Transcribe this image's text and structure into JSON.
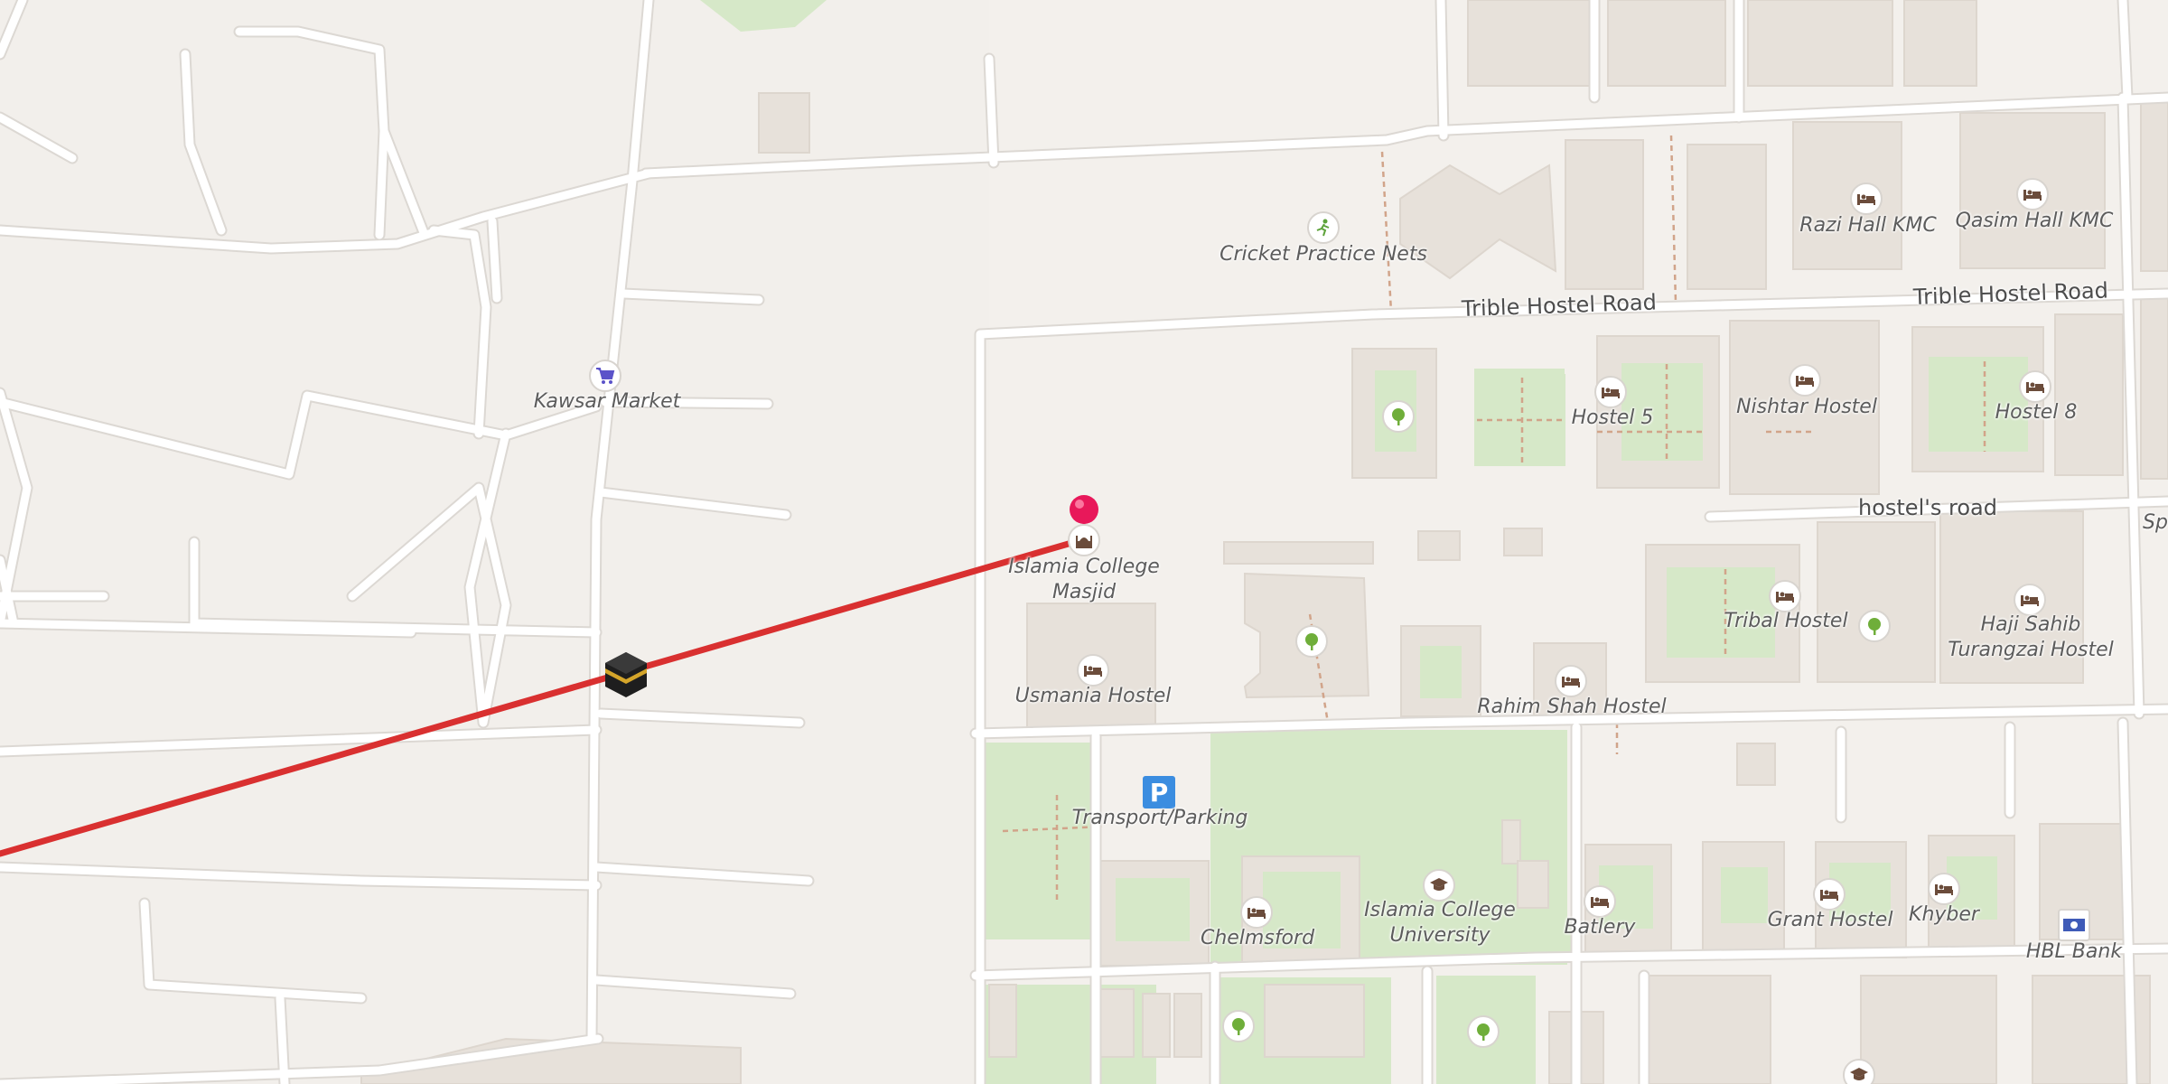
{
  "map": {
    "colors": {
      "background": "#f3f0ec",
      "road": "#ffffff",
      "road_casing": "#dcd8d3",
      "building": "#e8e2dc",
      "green": "#d6e8c8",
      "route": "#d93030",
      "pin": "#e8185a",
      "path": "#d1a48a"
    },
    "destination_pin": {
      "icon": "pin-marker"
    },
    "origin_marker": {
      "icon": "kaaba-icon"
    },
    "roads": {
      "trible_hostel_road_1": "Trible Hostel Road",
      "trible_hostel_road_2": "Trible Hostel Road",
      "hostels_road": "hostel's road",
      "edge_fragment": "Sp"
    },
    "pois": {
      "cricket": {
        "label": "Cricket Practice Nets",
        "icon": "sports-icon"
      },
      "razi": {
        "label": "Razi Hall KMC",
        "icon": "bed-icon"
      },
      "qasim": {
        "label": "Qasim Hall KMC",
        "icon": "bed-icon"
      },
      "kawsar": {
        "label": "Kawsar Market",
        "icon": "cart-icon"
      },
      "hostel5": {
        "label": "Hostel 5",
        "icon": "bed-icon"
      },
      "nishtar": {
        "label": "Nishtar Hostel",
        "icon": "bed-icon"
      },
      "hostel8": {
        "label": "Hostel 8",
        "icon": "bed-icon"
      },
      "masjid": {
        "label_line1": "Islamia College",
        "label_line2": "Masjid",
        "icon": "mosque-icon"
      },
      "tribal": {
        "label": "Tribal Hostel",
        "icon": "bed-icon"
      },
      "haji_line1": "Haji Sahib",
      "haji_line2": "Turangzai Hostel",
      "usmania": {
        "label": "Usmania Hostel",
        "icon": "bed-icon"
      },
      "rahim": {
        "label": "Rahim Shah Hostel",
        "icon": "bed-icon"
      },
      "parking": {
        "label": "Transport/Parking",
        "glyph": "P"
      },
      "chelmsford": {
        "label": "Chelmsford",
        "icon": "bed-icon"
      },
      "university": {
        "label_line1": "Islamia College",
        "label_line2": "University",
        "icon": "graduation-cap-icon"
      },
      "batlery": {
        "label": "Batlery",
        "icon": "bed-icon"
      },
      "grant": {
        "label": "Grant Hostel",
        "icon": "bed-icon"
      },
      "khyber": {
        "label": "Khyber",
        "icon": "bed-icon"
      },
      "hbl": {
        "label": "HBL Bank",
        "icon": "banknote-icon"
      },
      "park_icon": "tree-icon"
    }
  }
}
